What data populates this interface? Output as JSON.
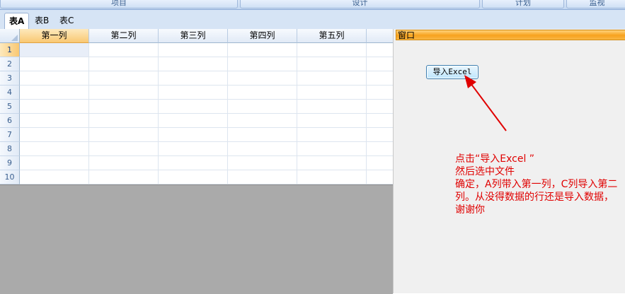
{
  "ribbon": {
    "tabs": [
      {
        "label": "项目"
      },
      {
        "label": "设计"
      },
      {
        "label": "计划"
      },
      {
        "label": "监视"
      }
    ]
  },
  "sheet_tabs": [
    {
      "label": "表A",
      "active": true
    },
    {
      "label": "表B",
      "active": false
    },
    {
      "label": "表C",
      "active": false
    }
  ],
  "grid": {
    "columns": [
      "第一列",
      "第二列",
      "第三列",
      "第四列",
      "第五列",
      "第"
    ],
    "rows": [
      "1",
      "2",
      "3",
      "4",
      "5",
      "6",
      "7",
      "8",
      "9",
      "10"
    ],
    "selected_column": 0,
    "selected_row": 0
  },
  "window": {
    "title": "窗口",
    "import_button": "导入Excel"
  },
  "note": {
    "lines": [
      "点击“导入Excel ”",
      "然后选中文件",
      "确定，A列带入第一列，C列导入第二列。从没得数据的行还是导入数据，谢谢你"
    ]
  },
  "colors": {
    "note": "#e00000",
    "window_title": "#f7a21e",
    "selected_header": "#f9c872"
  }
}
